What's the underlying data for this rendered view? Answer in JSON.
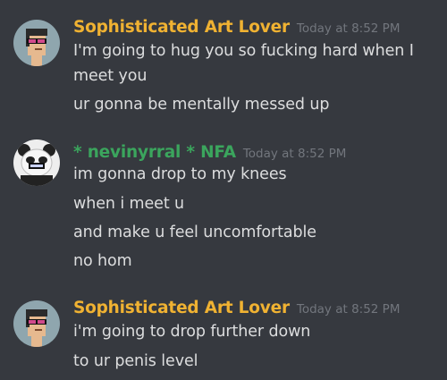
{
  "theme": {
    "background": "#36393f",
    "text": "#dcddde",
    "muted": "#72767d"
  },
  "messages": [
    {
      "author": "Sophisticated Art Lover",
      "author_color": "#f0b232",
      "timestamp": "Today at 8:52 PM",
      "avatar_icon": "pixel-punk-avatar-icon",
      "lines": [
        "I'm going to hug you so fucking hard when I",
        "meet you",
        "ur gonna be mentally messed up"
      ]
    },
    {
      "author": "* nevinyrral * NFA",
      "author_color": "#3ba55d",
      "timestamp": "Today at 8:52 PM",
      "avatar_icon": "panda-avatar-icon",
      "lines": [
        "im gonna drop to my knees",
        "when i meet u",
        "and make u feel uncomfortable",
        "no hom"
      ]
    },
    {
      "author": "Sophisticated Art Lover",
      "author_color": "#f0b232",
      "timestamp": "Today at 8:52 PM",
      "avatar_icon": "pixel-punk-avatar-icon",
      "lines": [
        "i'm going to drop further down",
        "to ur penis level"
      ]
    }
  ]
}
